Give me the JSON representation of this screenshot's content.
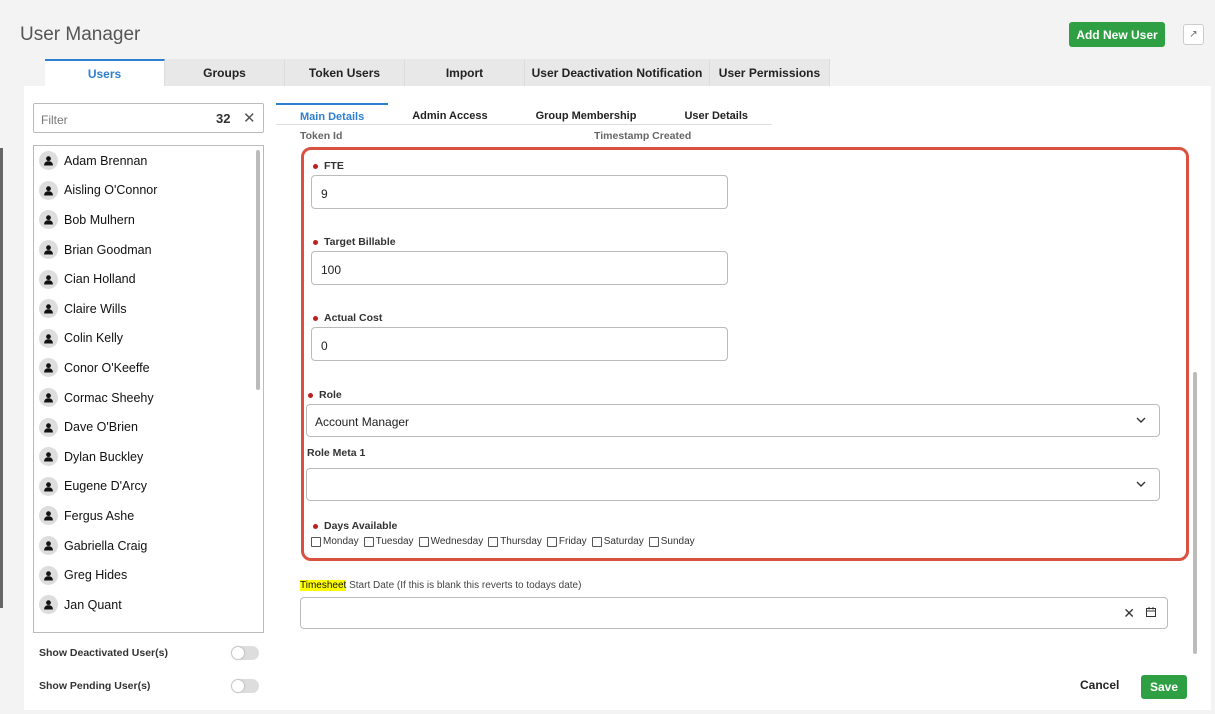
{
  "app": {
    "title": "User Manager"
  },
  "header": {
    "add_user_label": "Add New User",
    "expand_icon": "expand-icon"
  },
  "top_tabs": [
    {
      "label": "Users",
      "active": true
    },
    {
      "label": "Groups"
    },
    {
      "label": "Token Users"
    },
    {
      "label": "Import"
    },
    {
      "label": "User Deactivation Notification"
    },
    {
      "label": "User Permissions"
    }
  ],
  "filter": {
    "placeholder": "Filter",
    "count": "32",
    "clear_icon": "close-icon"
  },
  "users": [
    "Adam Brennan",
    "Aisling O'Connor",
    "Bob Mulhern",
    "Brian Goodman",
    "Cian Holland",
    "Claire Wills",
    "Colin Kelly",
    "Conor O'Keeffe",
    "Cormac Sheehy",
    "Dave O'Brien",
    "Dylan Buckley",
    "Eugene D'Arcy",
    "Fergus Ashe",
    "Gabriella Craig",
    "Greg Hides",
    "Jan Quant"
  ],
  "toggles": {
    "show_deactivated": {
      "label": "Show Deactivated User(s)",
      "on": false
    },
    "show_pending": {
      "label": "Show Pending User(s)",
      "on": false
    }
  },
  "sub_tabs": [
    {
      "label": "Main Details",
      "active": true
    },
    {
      "label": "Admin Access"
    },
    {
      "label": "Group Membership"
    },
    {
      "label": "User Details"
    }
  ],
  "meta": {
    "token_id": "Token Id",
    "timestamp_created": "Timestamp Created"
  },
  "form": {
    "fte": {
      "label": "FTE",
      "value": "9"
    },
    "target_billable": {
      "label": "Target Billable",
      "value": "100"
    },
    "actual_cost": {
      "label": "Actual Cost",
      "value": "0"
    },
    "role": {
      "label": "Role",
      "value": "Account Manager"
    },
    "role_meta_1": {
      "label": "Role Meta 1",
      "value": ""
    },
    "days_available": {
      "label": "Days Available",
      "days": [
        "Monday",
        "Tuesday",
        "Wednesday",
        "Thursday",
        "Friday",
        "Saturday",
        "Sunday"
      ]
    },
    "timesheet": {
      "highlight": "Timesheet",
      "label_rest": " Start Date (If this is blank this reverts to todays date)",
      "value": ""
    }
  },
  "footer": {
    "cancel_label": "Cancel",
    "save_label": "Save"
  },
  "colors": {
    "accent": "#2f7fd1",
    "primary_button": "#2ea043",
    "highlight_border": "#d9523f",
    "required": "#c01f1f"
  }
}
